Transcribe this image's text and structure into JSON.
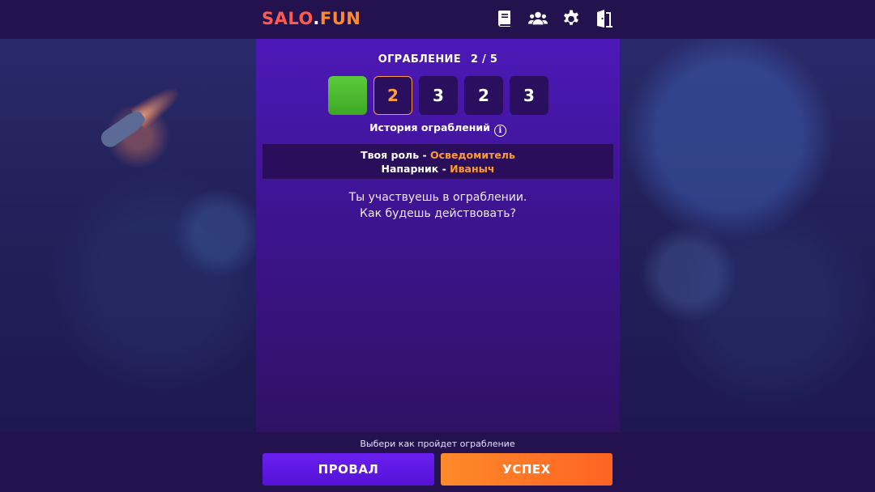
{
  "header": {
    "logo_part1": "SALO",
    "logo_dot": ".",
    "logo_part2": "FUN",
    "icons": [
      "book-icon",
      "users-icon",
      "gear-icon",
      "exit-door-icon"
    ]
  },
  "round": {
    "title": "ОГРАБЛЕНИЕ",
    "progress": "2 / 5",
    "boxes": [
      {
        "state": "done",
        "value": ""
      },
      {
        "state": "current",
        "value": "2"
      },
      {
        "state": "pending",
        "value": "3"
      },
      {
        "state": "pending",
        "value": "2"
      },
      {
        "state": "pending",
        "value": "3"
      }
    ],
    "history_label": "История ограблений",
    "info_glyph": "i"
  },
  "role": {
    "role_label": "Твоя роль - ",
    "role_value": "Осведомитель",
    "partner_label": "Напарник - ",
    "partner_value": "Иваныч"
  },
  "message": {
    "line1": "Ты участвуешь в ограблении.",
    "line2": "Как будешь действовать?"
  },
  "bottom": {
    "hint": "Выбери как пройдет ограбление",
    "fail_label": "ПРОВАЛ",
    "success_label": "УСПЕХ"
  },
  "colors": {
    "accent": "#ff9a2e",
    "success_box": "#4fb932",
    "panel": "#4d18b8",
    "fail_button": "#5f18e6",
    "success_button": "#ff7426"
  }
}
